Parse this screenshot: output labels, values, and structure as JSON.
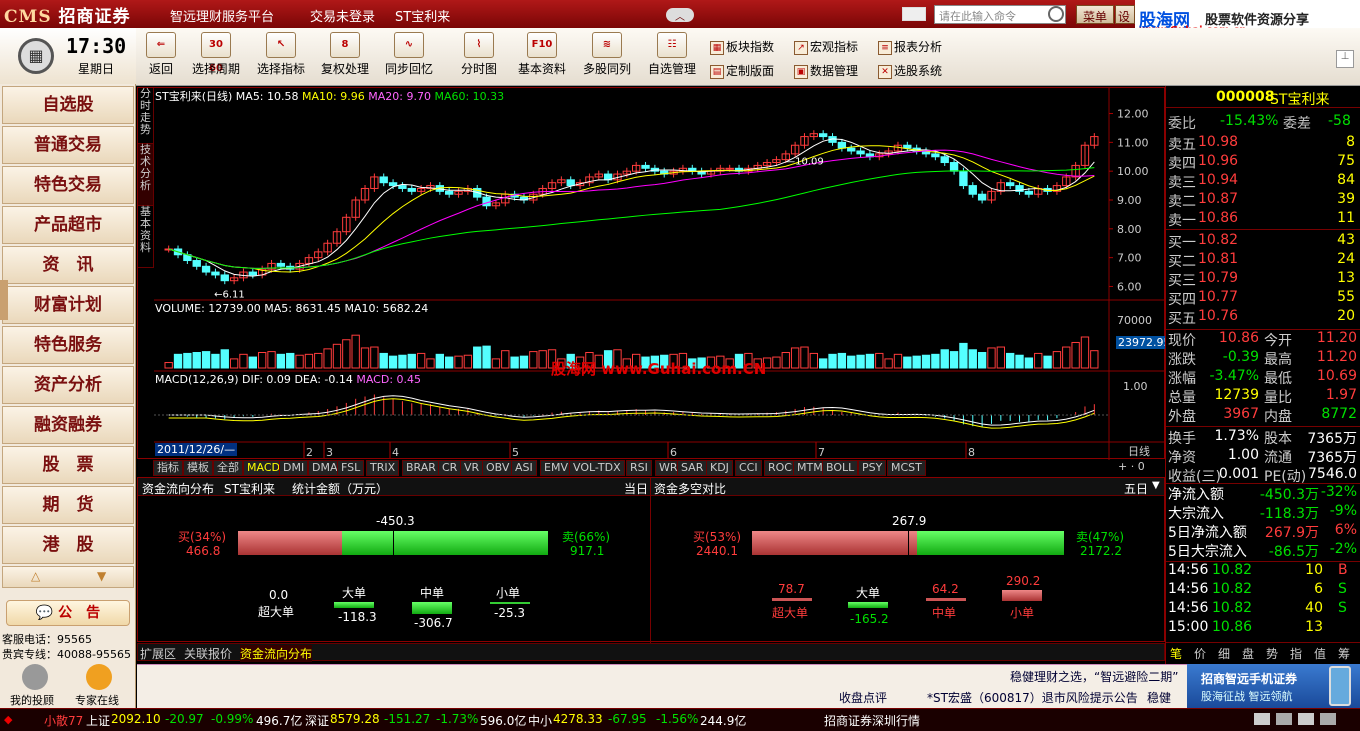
{
  "titlebar": {
    "logo_cms": "CMS",
    "logo_brand": "招商证券",
    "nav1": "智远理财服务平台",
    "nav2": "交易未登录",
    "nav3": "ST宝利来",
    "search_placeholder": "请在此输入命令",
    "menu_btn": "菜单",
    "settings_btn": "设"
  },
  "brand": {
    "name": "股海网",
    "slogan": "股票软件资源分享",
    "url": "www.Guhai.com.cn"
  },
  "toolbar": {
    "back": "返回",
    "period": "选择周期",
    "indicator": "选择指标",
    "rights": "复权处理",
    "sync": "同步回忆",
    "minute": "分时图",
    "basic": "基本资料",
    "multi": "多股同列",
    "watchlist": "自选管理",
    "f10": "F10",
    "sector": "板块指数",
    "macro": "宏观指标",
    "report": "报表分析",
    "custom": "定制版面",
    "data": "数据管理",
    "picker": "选股系统"
  },
  "clock": {
    "time": "17:30",
    "weekday": "星期日"
  },
  "leftnav": [
    "自选股",
    "普通交易",
    "特色交易",
    "产品超市",
    "资　讯",
    "财富计划",
    "特色服务",
    "资产分析",
    "融资融券",
    "股　票",
    "期　货",
    "港　股"
  ],
  "notice": {
    "label": "公　告",
    "phone_label": "客服电话：95565",
    "vip": "贵宾专线：40088-95565",
    "my_advisor": "我的投顾",
    "expert": "专家在线"
  },
  "chart": {
    "vtabs": [
      "分时走势",
      "技术分析",
      "基本资料"
    ],
    "header": {
      "name": "ST宝利来(日线)",
      "ma5": "MA5: 10.58",
      "ma10": "MA10: 9.96",
      "ma20": "MA20: 9.70",
      "ma60": "MA60: 10.33"
    },
    "yticks": [
      "12.00",
      "11.00",
      "10.00",
      "9.00",
      "8.00",
      "7.00",
      "6.00"
    ],
    "low_label": "6.11",
    "high_label": "10.09",
    "volume_header": {
      "label": "VOLUME: 12739.00",
      "ma5": "MA5: 8631.45",
      "ma10": "MA10: 5682.24"
    },
    "vol_tick": "70000",
    "vol_current": "23972.95",
    "macd_header": {
      "label": "MACD(12,26,9)",
      "dif": "DIF: 0.09",
      "dea": "DEA: -0.14",
      "macd": "MACD: 0.45"
    },
    "macd_tick": "1.00",
    "date_start": "2011/12/26/—",
    "months": [
      "2",
      "3",
      "4",
      "5",
      "6",
      "7",
      "8"
    ],
    "period_label": "日线",
    "watermark": "股海网 www.Guhai.com.CN",
    "tabs": [
      "指标",
      "模板",
      "全部",
      "MACD",
      "DMI",
      "DMA",
      "FSL",
      "TRIX",
      "BRAR",
      "CR",
      "VR",
      "OBV",
      "ASI",
      "EMV",
      "VOL-TDX",
      "RSI",
      "WR",
      "SAR",
      "KDJ",
      "CCI",
      "ROC",
      "MTM",
      "BOLL",
      "PSY",
      "MCST"
    ]
  },
  "chart_data": {
    "type": "candlestick",
    "title": "ST宝利来(日线)",
    "ylim": [
      5.6,
      12.4
    ],
    "low": 6.11,
    "high": 10.09,
    "close_series": [
      7.3,
      7.1,
      6.9,
      6.7,
      6.5,
      6.4,
      6.2,
      6.3,
      6.5,
      6.4,
      6.6,
      6.8,
      6.7,
      6.6,
      6.8,
      7.0,
      7.2,
      7.5,
      7.9,
      8.4,
      9.0,
      9.4,
      9.8,
      9.6,
      9.5,
      9.4,
      9.3,
      9.4,
      9.5,
      9.3,
      9.2,
      9.3,
      9.4,
      9.1,
      8.8,
      8.9,
      9.2,
      9.1,
      9.0,
      9.2,
      9.4,
      9.6,
      9.7,
      9.5,
      9.6,
      9.8,
      9.9,
      9.7,
      9.9,
      10.0,
      10.2,
      10.1,
      10.0,
      9.9,
      10.0,
      10.1,
      10.0,
      9.9,
      10.0,
      10.1,
      10.1,
      10.0,
      10.1,
      10.2,
      10.3,
      10.4,
      10.6,
      10.9,
      11.2,
      11.3,
      11.2,
      11.0,
      10.8,
      10.7,
      10.6,
      10.5,
      10.6,
      10.7,
      10.9,
      10.8,
      10.7,
      10.6,
      10.5,
      10.3,
      10.0,
      9.5,
      9.2,
      9.0,
      9.3,
      9.6,
      9.5,
      9.3,
      9.2,
      9.4,
      9.3,
      9.5,
      9.8,
      10.2,
      10.9,
      11.2
    ],
    "volume_ylim": [
      0,
      70000
    ]
  },
  "bottom": {
    "left_title": "资金流向分布",
    "stock": "ST宝利来",
    "stat": "统计金额（万元）",
    "day": "当日",
    "buy_pct": "买(34%)",
    "buy_val": "466.8",
    "sell_pct": "卖(66%)",
    "sell_val": "917.1",
    "net": "-450.3",
    "super_val": "0.0",
    "super_label": "超大单",
    "big_label": "大单",
    "big_val": "-118.3",
    "mid_label": "中单",
    "mid_val": "-306.7",
    "small_label": "小单",
    "small_val": "-25.3",
    "right_title": "资金多空对比",
    "right_day": "五日",
    "r_buy_pct": "买(53%)",
    "r_buy_val": "2440.1",
    "r_sell_pct": "卖(47%)",
    "r_sell_val": "2172.2",
    "r_net": "267.9",
    "r_super_val": "78.7",
    "r_super_label": "超大单",
    "r_big_label": "大单",
    "r_big_val": "-165.2",
    "r_mid_val": "64.2",
    "r_mid_label": "中单",
    "r_small_val": "290.2",
    "r_small_label": "小单",
    "tabs": [
      "扩展区",
      "关联报价",
      "资金流向分布"
    ]
  },
  "quote": {
    "code": "000008",
    "name": "ST宝利来",
    "wb_label": "委比",
    "wb": "-15.43%",
    "wc_label": "委差",
    "wc": "-58",
    "sells": [
      [
        "卖五",
        "10.98",
        "8"
      ],
      [
        "卖四",
        "10.96",
        "75"
      ],
      [
        "卖三",
        "10.94",
        "84"
      ],
      [
        "卖二",
        "10.87",
        "39"
      ],
      [
        "卖一",
        "10.86",
        "11"
      ]
    ],
    "buys": [
      [
        "买一",
        "10.82",
        "43"
      ],
      [
        "买二",
        "10.81",
        "24"
      ],
      [
        "买三",
        "10.79",
        "13"
      ],
      [
        "买四",
        "10.77",
        "55"
      ],
      [
        "买五",
        "10.76",
        "20"
      ]
    ],
    "stats": [
      [
        "现价",
        "10.86",
        "今开",
        "11.20"
      ],
      [
        "涨跌",
        "-0.39",
        "最高",
        "11.20"
      ],
      [
        "涨幅",
        "-3.47%",
        "最低",
        "10.69"
      ],
      [
        "总量",
        "12739",
        "量比",
        "1.97"
      ],
      [
        "外盘",
        "3967",
        "内盘",
        "8772"
      ],
      [
        "换手",
        "1.73%",
        "股本",
        "7365万"
      ],
      [
        "净资",
        "1.00",
        "流通",
        "7365万"
      ],
      [
        "收益(三)",
        "0.001",
        "PE(动)",
        "7546.0"
      ]
    ],
    "flow": [
      [
        "净流入额",
        "-450.3万",
        "-32%"
      ],
      [
        "大宗流入",
        "-118.3万",
        "-9%"
      ],
      [
        "5日净流入额",
        "267.9万",
        "6%"
      ],
      [
        "5日大宗流入",
        "-86.5万",
        "-2%"
      ]
    ],
    "ticks": [
      [
        "14:56",
        "10.82",
        "10",
        "B"
      ],
      [
        "14:56",
        "10.82",
        "6",
        "S"
      ],
      [
        "14:56",
        "10.82",
        "40",
        "S"
      ],
      [
        "15:00",
        "10.86",
        "13",
        ""
      ]
    ],
    "tabs": [
      "笔",
      "价",
      "细",
      "盘",
      "势",
      "指",
      "值",
      "筹"
    ]
  },
  "ticker": {
    "line1": "稳健理财之选，“智远避险二期”",
    "line2a": "收盘点评",
    "line2b": "*ST宏盛（600817）退市风险提示公告",
    "line2c": "稳健"
  },
  "ad": {
    "title": "招商智远手机证券",
    "sub": "股海征战 智远领航"
  },
  "status": {
    "user": "小散77",
    "sh_label": "上证",
    "sh": "2092.10",
    "sh_chg": "-20.97",
    "sh_pct": "-0.99%",
    "sh_amt": "496.7亿",
    "sz_label": "深证",
    "sz": "8579.28",
    "sz_chg": "-151.27",
    "sz_pct": "-1.73%",
    "sz_amt": "596.0亿",
    "zx_label": "中小",
    "zx": "4278.33",
    "zx_chg": "-67.95",
    "zx_pct": "-1.56%",
    "zx_amt": "244.9亿",
    "broker": "招商证券深圳行情"
  }
}
